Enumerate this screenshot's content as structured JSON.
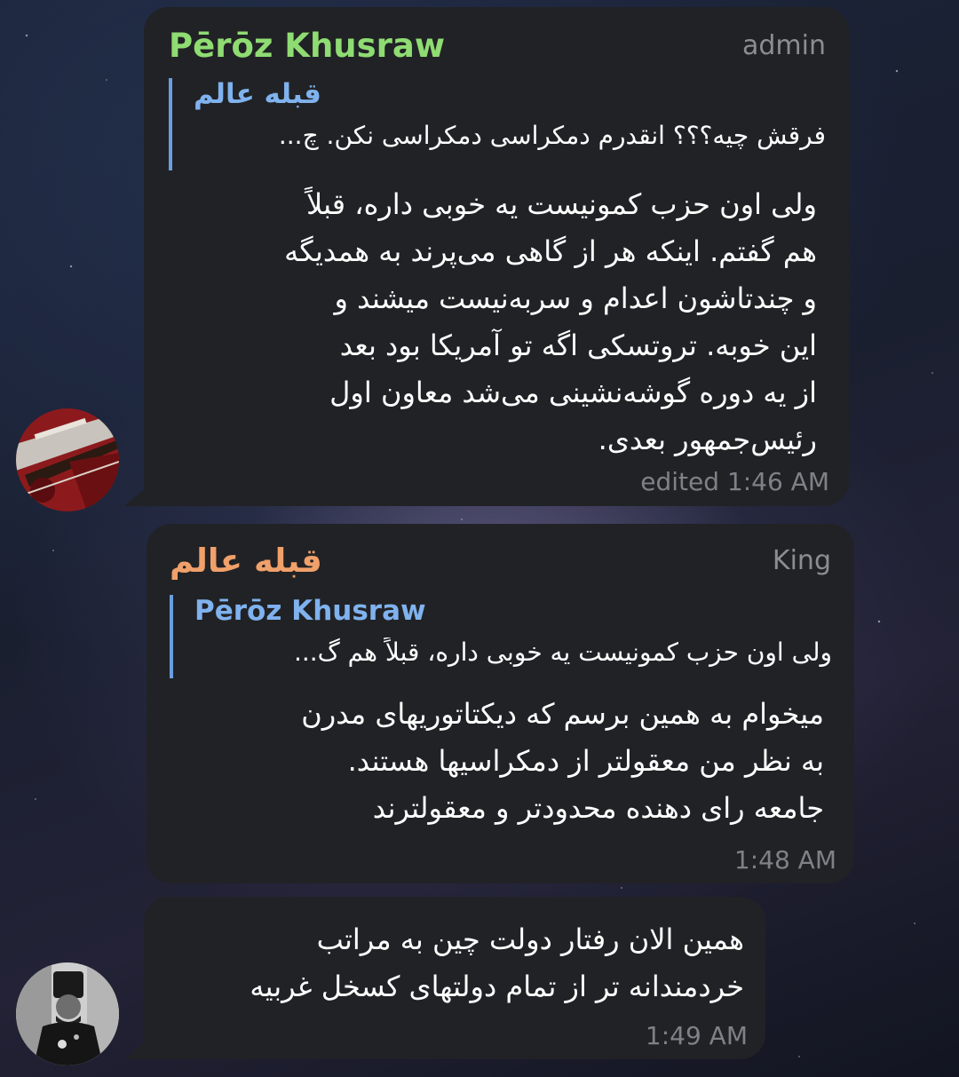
{
  "messages": [
    {
      "sender": "Pērōz Khusraw",
      "sender_color": "#8fdc72",
      "role": "admin",
      "reply": {
        "name": "قبله عالم",
        "text": "فرقش چیه؟؟؟ انقدرم دمکراسی دمکراسی نکن. چ..."
      },
      "lines": [
        "ولی اون حزب کمونیست یه خوبی داره، قبلاً",
        "هم گفتم. اینکه هر از گاهی می‌پرند به همدیگه",
        "و چندتاشون اعدام و سربه‌نیست میشند و",
        "این خوبه. تروتسکی اگه تو آمریکا بود بعد",
        "از یه دوره گوشه‌نشینی می‌شد معاون اول",
        "رئیس‌جمهور بعدی."
      ],
      "time": "edited 1:46 AM",
      "avatar_icon": "guitar-photo-avatar"
    },
    {
      "sender": "قبله عالم",
      "sender_color": "#f0a06a",
      "role": "King",
      "reply": {
        "name": "Pērōz Khusraw",
        "text": "ولی اون حزب کمونیست یه خوبی داره، قبلاً هم گ..."
      },
      "lines": [
        "میخوام به همین برسم که دیکتاتوریهای مدرن",
        "به نظر من معقولتر از دمکراسیها هستند.",
        "جامعه رای دهنده محدودتر و معقولترند"
      ],
      "time": "1:48 AM"
    },
    {
      "lines": [
        "همین الان رفتار دولت چین به مراتب",
        "خردمندانه تر از تمام دولتهای کسخل غربیه"
      ],
      "time": "1:49 AM",
      "avatar_icon": "portrait-photo-avatar"
    }
  ]
}
